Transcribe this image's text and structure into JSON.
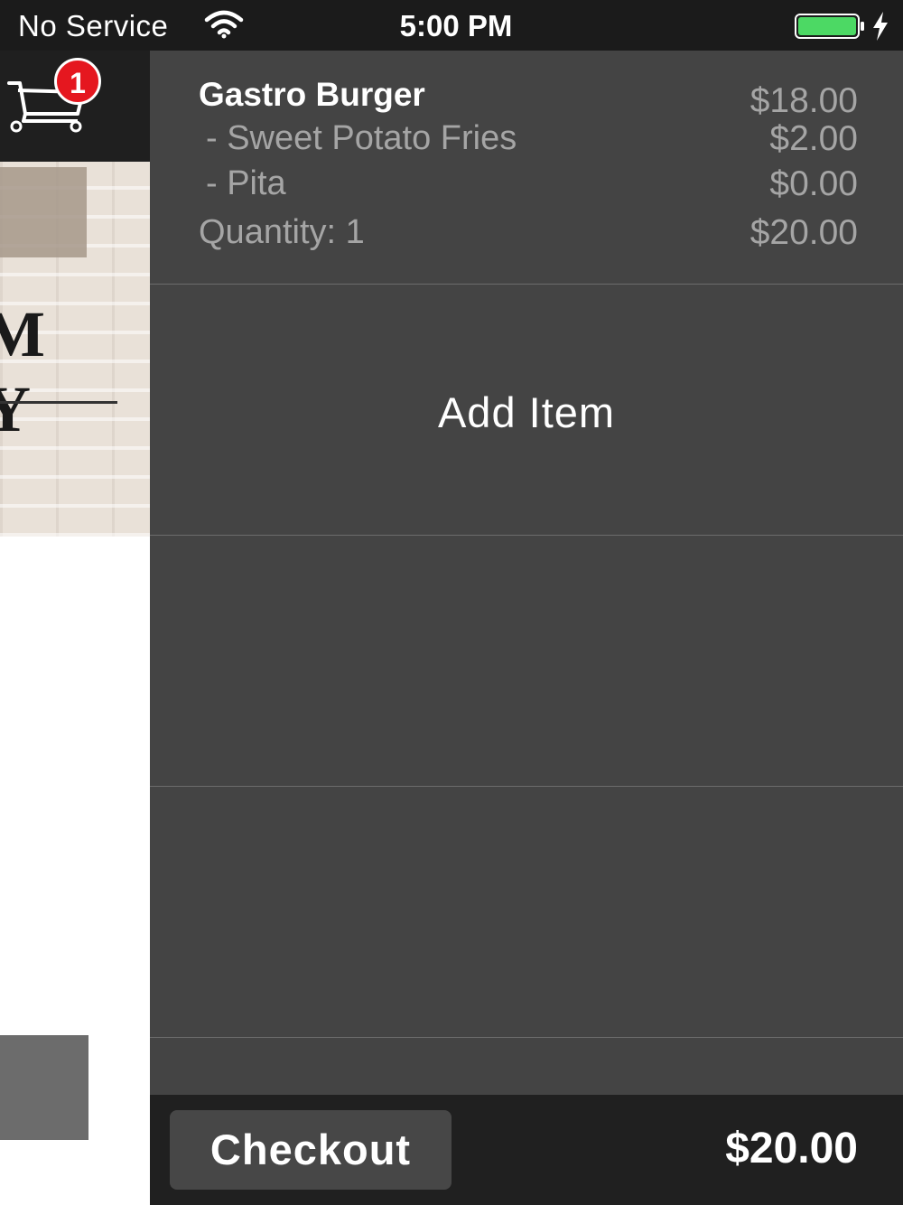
{
  "status_bar": {
    "carrier": "No Service",
    "time": "5:00 PM",
    "battery_level": 1.0,
    "battery_color": "#4cd964",
    "icons": [
      "wifi-icon",
      "battery-icon",
      "charging-bolt-icon"
    ]
  },
  "background_app": {
    "cart_badge_count": "1",
    "hero_text": "M Y",
    "icons": [
      "shopping-cart-icon"
    ]
  },
  "cart": {
    "items": [
      {
        "name": "Gastro Burger",
        "price": "$18.00",
        "options": [
          {
            "name": "- Sweet Potato Fries",
            "price": "$2.00"
          },
          {
            "name": "- Pita",
            "price": "$0.00"
          }
        ],
        "quantity_label": "Quantity: 1",
        "line_total": "$20.00"
      }
    ],
    "add_item_label": "Add Item",
    "checkout_label": "Checkout",
    "total": "$20.00"
  },
  "colors": {
    "panel_bg": "#444444",
    "footer_bg": "#202020",
    "badge_red": "#e5171f",
    "muted_text": "#a5a5a5"
  }
}
